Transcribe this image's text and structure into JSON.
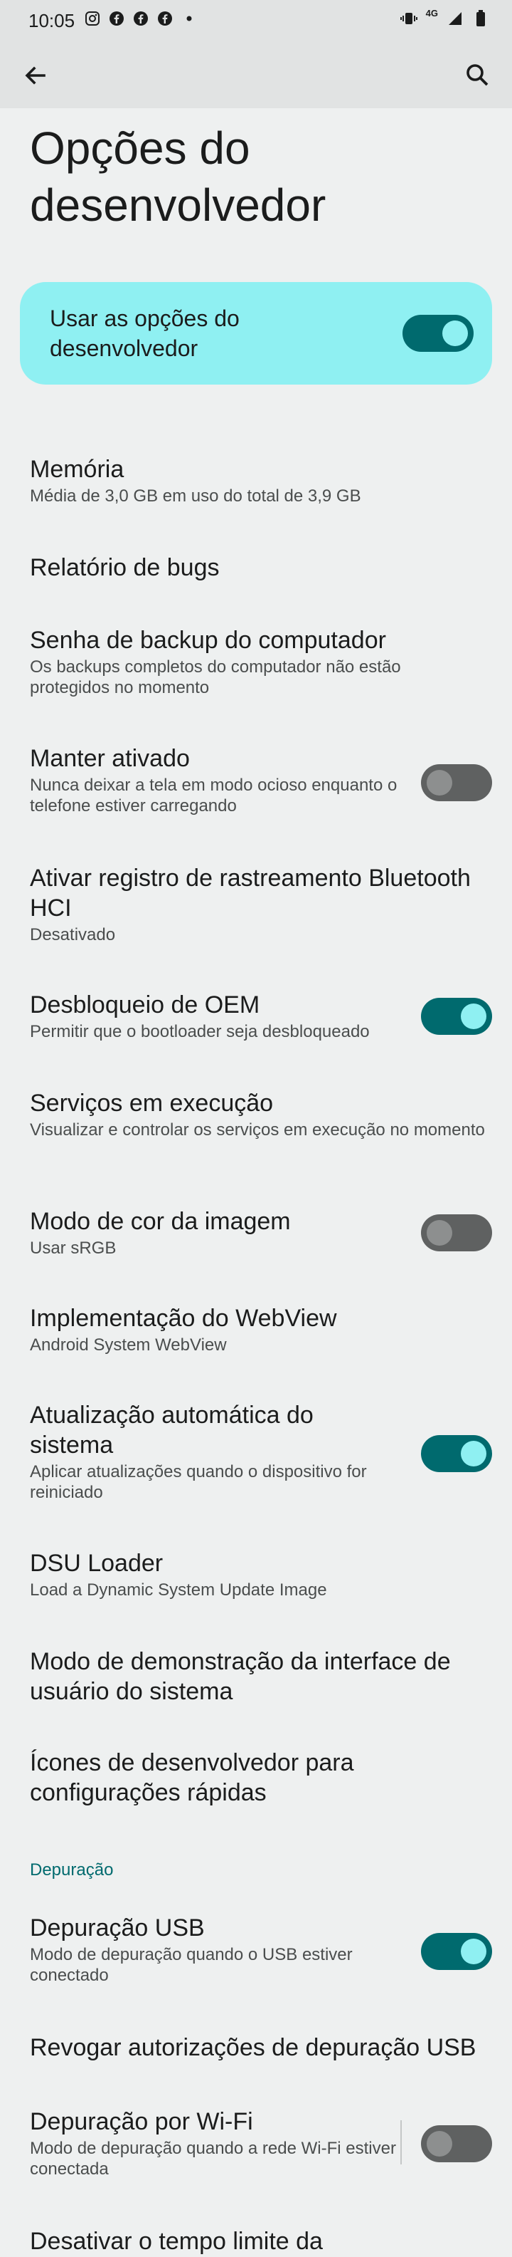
{
  "status_bar": {
    "time": "10:05",
    "left_icons": [
      "instagram-icon",
      "facebook-icon",
      "facebook-icon",
      "facebook-icon",
      "dot-icon"
    ],
    "network": "4G"
  },
  "app_bar": {
    "back_icon": "arrow-left-icon",
    "search_icon": "search-icon"
  },
  "page": {
    "title": "Opções do desenvolvedor"
  },
  "master_switch": {
    "label": "Usar as opções do desenvolvedor",
    "on": true
  },
  "items": [
    {
      "title": "Memória",
      "subtitle": "Média de 3,0 GB em uso do total de 3,9 GB"
    },
    {
      "title": "Relatório de bugs",
      "subtitle": ""
    },
    {
      "title": "Senha de backup do computador",
      "subtitle": "Os backups completos do computador não estão protegidos no momento"
    },
    {
      "title": "Manter ativado",
      "subtitle": "Nunca deixar a tela em modo ocioso enquanto o telefone estiver carregando",
      "toggle": false
    },
    {
      "title": "Ativar registro de rastreamento Bluetooth HCI",
      "subtitle": "Desativado"
    },
    {
      "title": "Desbloqueio de OEM",
      "subtitle": "Permitir que o bootloader seja desbloqueado",
      "toggle": true
    },
    {
      "title": "Serviços em execução",
      "subtitle": "Visualizar e controlar os serviços em execução no momento"
    },
    {
      "title": "Modo de cor da imagem",
      "subtitle": "Usar sRGB",
      "toggle": false
    },
    {
      "title": "Implementação do WebView",
      "subtitle": "Android System WebView"
    },
    {
      "title": "Atualização automática do sistema",
      "subtitle": "Aplicar atualizações quando o dispositivo for reiniciado",
      "toggle": true
    },
    {
      "title": "DSU Loader",
      "subtitle": "Load a Dynamic System Update Image"
    },
    {
      "title": "Modo de demonstração da interface de usuário do sistema",
      "subtitle": ""
    },
    {
      "title": "Ícones de desenvolvedor para configurações rápidas",
      "subtitle": ""
    },
    {
      "title": "Depuração USB",
      "subtitle": "Modo de depuração quando o USB estiver conectado",
      "toggle": true
    },
    {
      "title": "Revogar autorizações de depuração USB",
      "subtitle": ""
    },
    {
      "title": "Depuração por Wi-Fi",
      "subtitle": "Modo de depuração quando a rede Wi-Fi estiver conectada",
      "toggle": false
    },
    {
      "title": "Desativar o tempo limite da",
      "subtitle": ""
    }
  ],
  "sections": {
    "debug_header": "Depuração"
  },
  "colors": {
    "background": "#eef0f0",
    "appbar": "#e1e3e3",
    "accent": "#006a6e",
    "accent_light": "#8ff0f2",
    "toggle_off_track": "#5f6161",
    "toggle_off_knob": "#8d8f8f"
  }
}
